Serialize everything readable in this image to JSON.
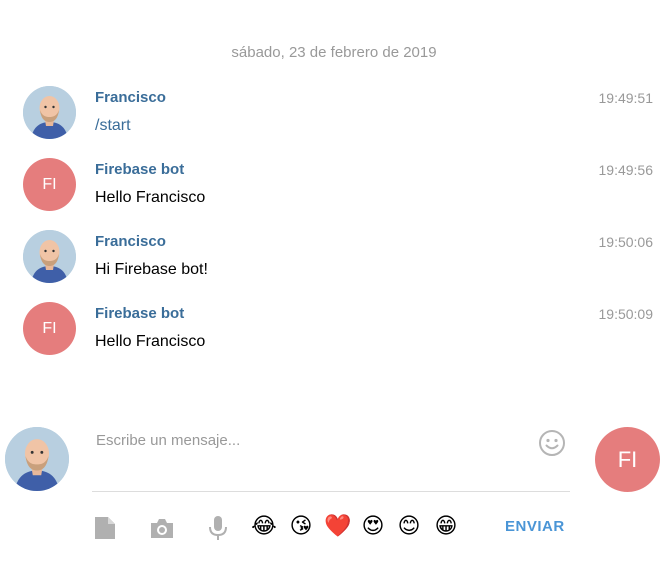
{
  "date_separator": "sábado, 23 de febrero de 2019",
  "messages": [
    {
      "sender": "Francisco",
      "time": "19:49:51",
      "text": "/start",
      "avatar": "photo"
    },
    {
      "sender": "Firebase bot",
      "time": "19:49:56",
      "text": "Hello Francisco",
      "avatar_initials": "FI"
    },
    {
      "sender": "Francisco",
      "time": "19:50:06",
      "text": "Hi Firebase bot!",
      "avatar": "photo"
    },
    {
      "sender": "Firebase bot",
      "time": "19:50:09",
      "text": "Hello Francisco",
      "avatar_initials": "FI"
    }
  ],
  "compose": {
    "placeholder": "Escribe un mensaje...",
    "send_label": "ENVIAR",
    "peer_initials": "FI"
  },
  "toolbar": {
    "icons": [
      "file-icon",
      "camera-icon",
      "microphone-icon"
    ],
    "emojis": [
      "😂",
      "😘",
      "❤️",
      "😍",
      "😊",
      "😁"
    ]
  },
  "colors": {
    "accent": "#3a6d99",
    "send": "#4a95d6",
    "bot_avatar": "#e57d7d",
    "muted": "#999999"
  }
}
